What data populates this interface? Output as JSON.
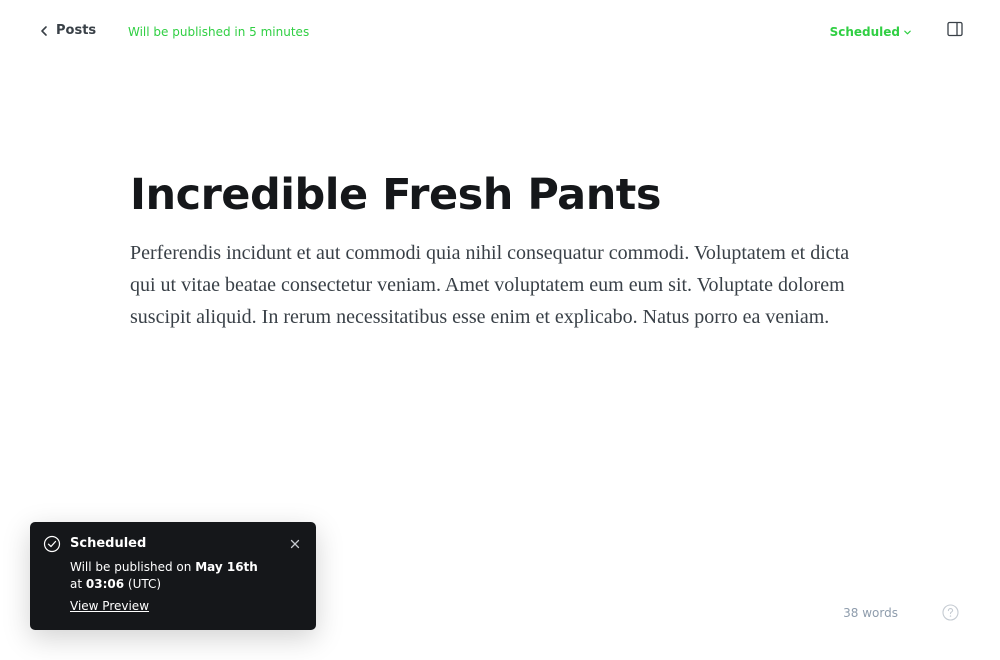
{
  "topbar": {
    "back_label": "Posts",
    "status_text": "Will be published in 5 minutes",
    "status_dropdown_label": "Scheduled",
    "status_color": "#30cf43"
  },
  "post": {
    "title": "Incredible Fresh Pants",
    "body": "Perferendis incidunt et aut commodi quia nihil consequatur commodi. Voluptatem et dicta qui ut vitae beatae consectetur veniam. Amet voluptatem eum eum sit. Voluptate dolorem suscipit aliquid. In rerum necessitatibus esse enim et explicabo. Natus porro ea veniam."
  },
  "toast": {
    "title": "Scheduled",
    "message_prefix": "Will be published on ",
    "date": "May 16th",
    "at_label": "at ",
    "time": "03:06",
    "timezone": " (UTC)",
    "link_label": "View Preview",
    "icon": "check-circle-icon",
    "close_icon": "close-icon"
  },
  "footer": {
    "word_count": "38 words",
    "help_icon": "help-circle-icon"
  }
}
